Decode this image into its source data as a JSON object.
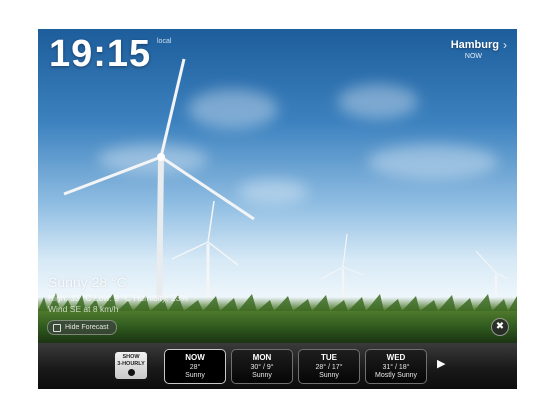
{
  "clock": {
    "time": "19:15",
    "zone": "local"
  },
  "location": {
    "city": "Hamburg",
    "when": "NOW"
  },
  "current": {
    "condition": "Sunny 28 °C",
    "details": "High: 33 °C  Low: 9 °C  Humidity: 23%",
    "extra": "Wind SE at 8 km/h"
  },
  "controls": {
    "hide_forecast": "Hide Forecast",
    "show_3hourly_line1": "SHOW",
    "show_3hourly_line2": "3-HOURLY"
  },
  "forecast": [
    {
      "day": "NOW",
      "temp": "28°",
      "condition": "Sunny"
    },
    {
      "day": "MON",
      "temp": "30° / 9°",
      "condition": "Sunny"
    },
    {
      "day": "TUE",
      "temp": "28° / 17°",
      "condition": "Sunny"
    },
    {
      "day": "WED",
      "temp": "31° / 18°",
      "condition": "Mostly Sunny"
    }
  ],
  "icons": [
    "chevron-right-icon",
    "tools-icon",
    "forecast-icon",
    "next-arrow-icon"
  ],
  "colors": {
    "sky_top": "#1d5d9c",
    "grass": "#2f5a1e",
    "bar": "#1a1a1a"
  }
}
